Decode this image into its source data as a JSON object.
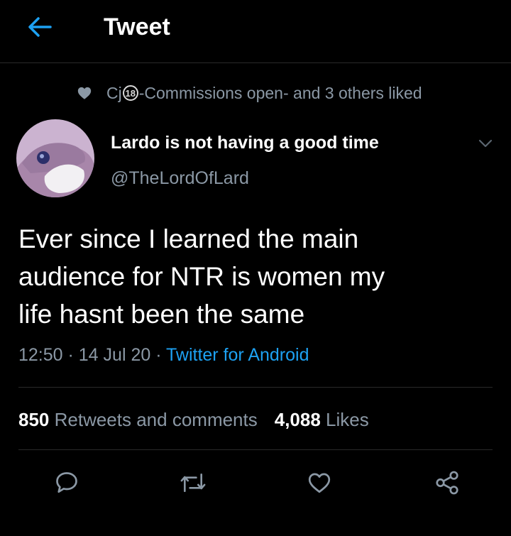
{
  "header": {
    "title": "Tweet",
    "back_icon": "arrow-left-icon"
  },
  "social_context": {
    "icon": "heart-icon",
    "name_prefix": "Cj",
    "badge": "18",
    "name_suffix": "-Commissions open-",
    "rest": " and 3 others liked"
  },
  "author": {
    "display_name": "Lardo is not having a good time",
    "handle": "@TheLordOfLard"
  },
  "tweet": {
    "lines": [
      "Ever since I learned the main",
      "audience for NTR is women my",
      "life hasnt been the same"
    ],
    "time": "12:50",
    "separator": " · ",
    "date": "14 Jul 20",
    "source": "Twitter for Android"
  },
  "stats": {
    "retweets_count": "850",
    "retweets_label": " Retweets and comments",
    "likes_count": "4,088",
    "likes_label": " Likes"
  },
  "actions": [
    "reply-icon",
    "retweet-icon",
    "like-icon",
    "share-icon"
  ],
  "colors": {
    "background": "#000000",
    "primary_text": "#ffffff",
    "secondary_text": "#8b98a5",
    "accent": "#1da1f2",
    "divider": "#2a2a2a"
  }
}
